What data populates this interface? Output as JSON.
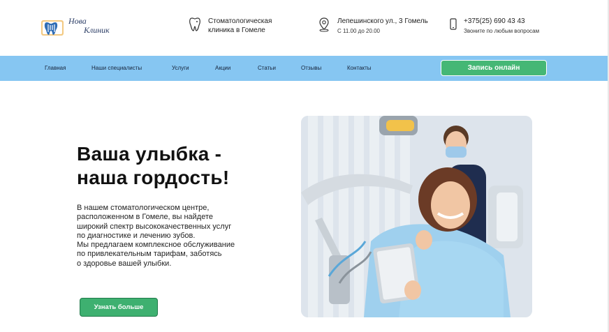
{
  "logo": {
    "line1": "Нова",
    "line2": "Клиник"
  },
  "header": {
    "clinic": {
      "line1": "Стоматологическая",
      "line2": "клиника в Гомеле",
      "icon": "tooth-icon"
    },
    "address": {
      "line1": "Лепешинского ул., 3 Гомель",
      "line2": "С 11.00 до 20.00",
      "icon": "map-pin-icon"
    },
    "phone": {
      "line1": "+375(25) 690 43 43",
      "line2": "Звоните по любым вопросам",
      "icon": "phone-icon"
    }
  },
  "nav": {
    "items": [
      {
        "label": "Главная"
      },
      {
        "label": "Наши специалисты"
      },
      {
        "label": "Услуги"
      },
      {
        "label": "Акции"
      },
      {
        "label": "Статьи"
      },
      {
        "label": "Отзывы"
      },
      {
        "label": "Контакты"
      }
    ],
    "cta_label": "Запись онлайн"
  },
  "hero": {
    "title_lines": [
      "Ваша улыбка -",
      "наша гордость!"
    ],
    "text_lines": [
      "В нашем стоматологическом центре,",
      "расположенном в Гомеле, вы найдете",
      "широкий спектр высококачественных услуг",
      "по диагностике и лечению зубов.",
      "Мы предлагаем комплексное обслуживание",
      "по привлекательным тарифам, заботясь",
      "о здоровье вашей улыбки."
    ],
    "button_label": "Узнать больше"
  },
  "colors": {
    "nav_background": "#86c6f2",
    "button_green": "#45b775",
    "logo_blue": "#2c3e66"
  }
}
